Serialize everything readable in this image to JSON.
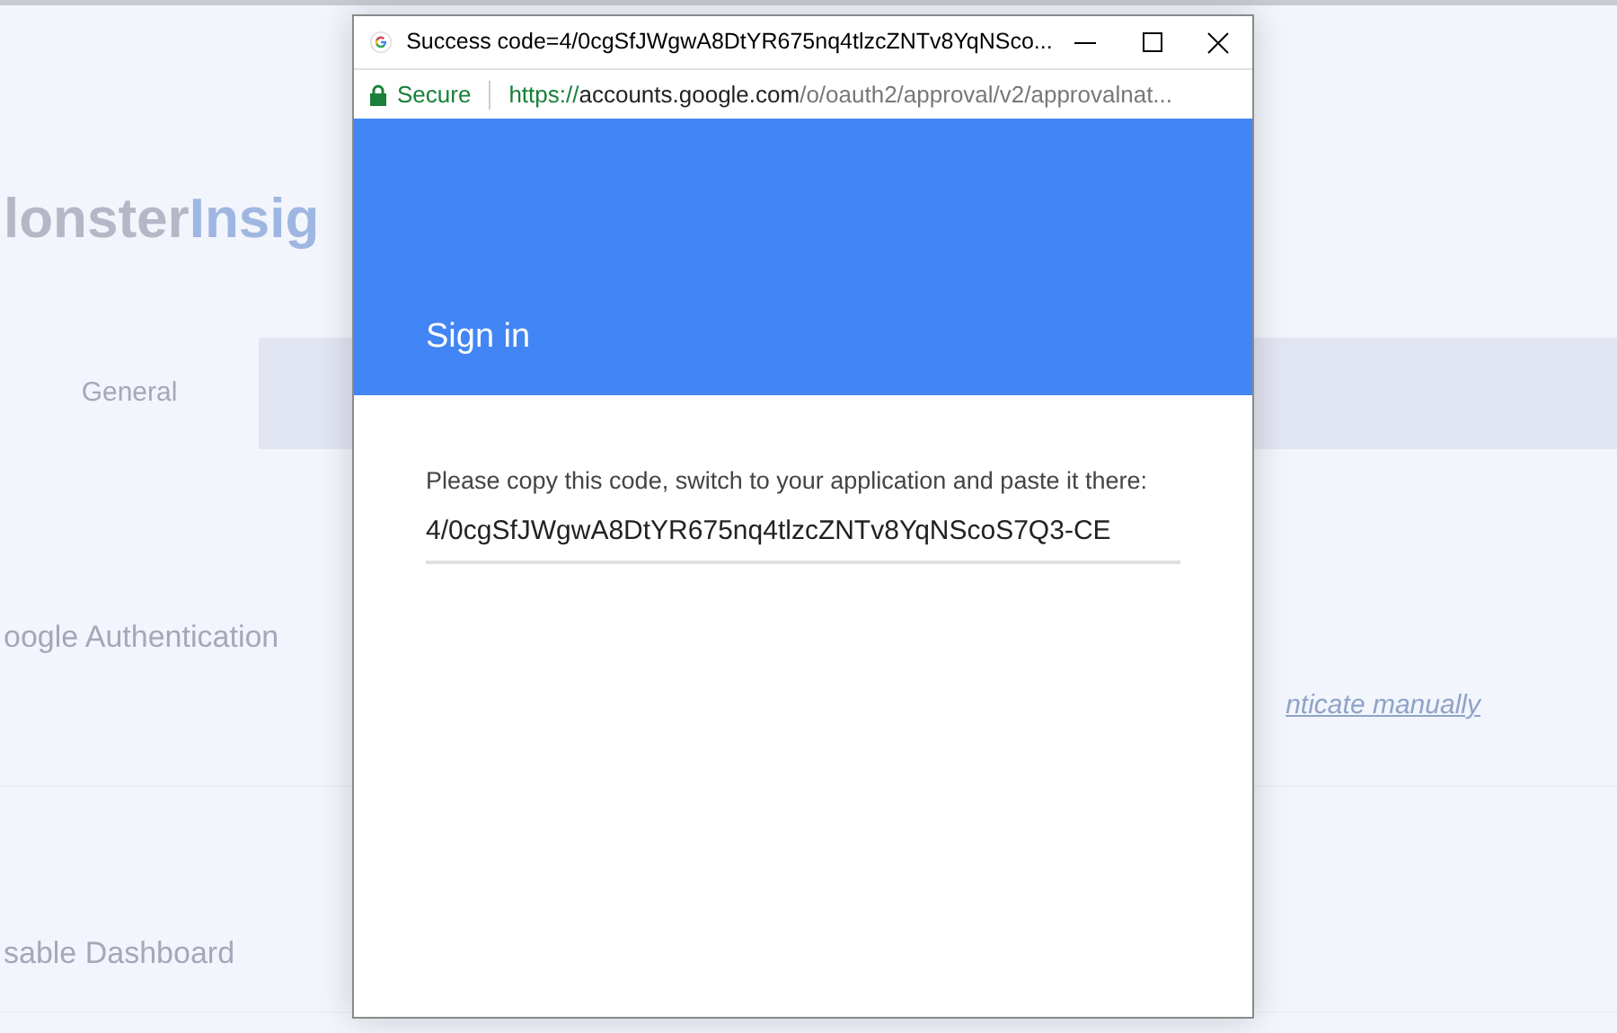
{
  "background_page": {
    "logo": {
      "part_1": "lonster",
      "part_2": "Insig"
    },
    "tabs": [
      {
        "label": "General",
        "selected": false
      }
    ],
    "settings": [
      {
        "label": "oogle Authentication",
        "link": "nticate manually"
      },
      {
        "label": "sable Dashboard"
      }
    ]
  },
  "popup": {
    "title": "Success code=4/0cgSfJWgwA8DtYR675nq4tlzcZNTv8YqNSco...",
    "security_label": "Secure",
    "url": {
      "scheme": "https://",
      "host": "accounts.google.com",
      "path": "/o/oauth2/approval/v2/approvalnat..."
    },
    "heading": "Sign in",
    "instruction": "Please copy this code, switch to your application and paste it there:",
    "code": "4/0cgSfJWgwA8DtYR675nq4tlzcZNTv8YqNScoS7Q3-CE"
  }
}
